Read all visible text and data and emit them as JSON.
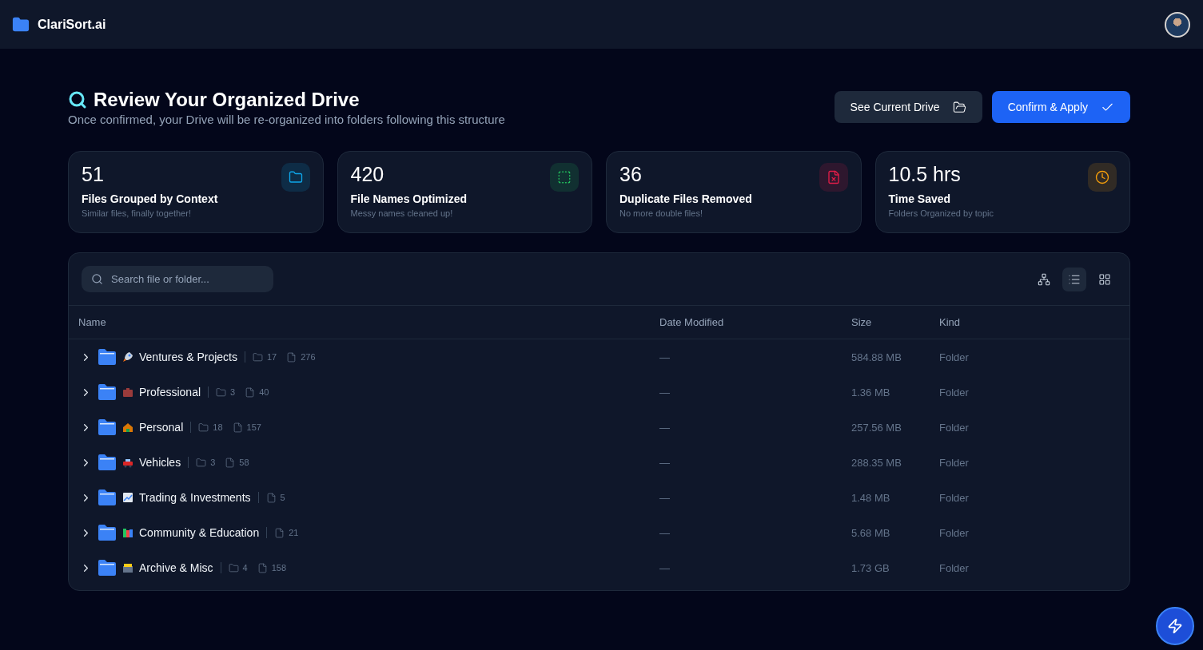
{
  "brand": {
    "name": "ClariSort.ai"
  },
  "header": {
    "title": "Review Your Organized Drive",
    "subtitle": "Once confirmed, your Drive will be re-organized into folders following this structure"
  },
  "actions": [
    {
      "kind": "secondary",
      "label": "See Current Drive"
    },
    {
      "kind": "primary",
      "label": "Confirm & Apply"
    }
  ],
  "stats": [
    {
      "value": "51",
      "title": "Files Grouped by Context",
      "caption": "Similar files, finally together!",
      "color": "#0ea5e9"
    },
    {
      "value": "420",
      "title": "File Names Optimized",
      "caption": "Messy names cleaned up!",
      "color": "#22c55e"
    },
    {
      "value": "36",
      "title": "Duplicate Files Removed",
      "caption": "No more double files!",
      "color": "#e11d48"
    },
    {
      "value": "10.5 hrs",
      "title": "Time Saved",
      "caption": "Folders Organized by topic",
      "color": "#f59e0b"
    }
  ],
  "search": {
    "placeholder": "Search file or folder..."
  },
  "views": [
    {
      "kind": "tree",
      "selected": false
    },
    {
      "kind": "list",
      "selected": true
    },
    {
      "kind": "grid",
      "selected": false
    }
  ],
  "table": {
    "columns": [
      "Name",
      "Date Modified",
      "Size",
      "Kind"
    ],
    "rows": [
      {
        "name": "Ventures & Projects",
        "counts": [
          {
            "kind": "folders",
            "value": "17"
          },
          {
            "kind": "files",
            "value": "276"
          }
        ],
        "date": "—",
        "size": "584.88 MB",
        "kind": "Folder",
        "expanded": false
      },
      {
        "name": "Professional",
        "counts": [
          {
            "kind": "folders",
            "value": "3"
          },
          {
            "kind": "files",
            "value": "40"
          }
        ],
        "date": "—",
        "size": "1.36 MB",
        "kind": "Folder",
        "expanded": false
      },
      {
        "name": "Personal",
        "counts": [
          {
            "kind": "folders",
            "value": "18"
          },
          {
            "kind": "files",
            "value": "157"
          }
        ],
        "date": "—",
        "size": "257.56 MB",
        "kind": "Folder",
        "expanded": false
      },
      {
        "name": "Vehicles",
        "counts": [
          {
            "kind": "folders",
            "value": "3"
          },
          {
            "kind": "files",
            "value": "58"
          }
        ],
        "date": "—",
        "size": "288.35 MB",
        "kind": "Folder",
        "expanded": false
      },
      {
        "name": "Trading & Investments",
        "counts": [
          {
            "kind": "files",
            "value": "5"
          }
        ],
        "date": "—",
        "size": "1.48 MB",
        "kind": "Folder",
        "expanded": false
      },
      {
        "name": "Community & Education",
        "counts": [
          {
            "kind": "files",
            "value": "21"
          }
        ],
        "date": "—",
        "size": "5.68 MB",
        "kind": "Folder",
        "expanded": false
      },
      {
        "name": "Archive & Misc",
        "counts": [
          {
            "kind": "folders",
            "value": "4"
          },
          {
            "kind": "files",
            "value": "158"
          }
        ],
        "date": "—",
        "size": "1.73 GB",
        "kind": "Folder",
        "expanded": false
      }
    ]
  }
}
